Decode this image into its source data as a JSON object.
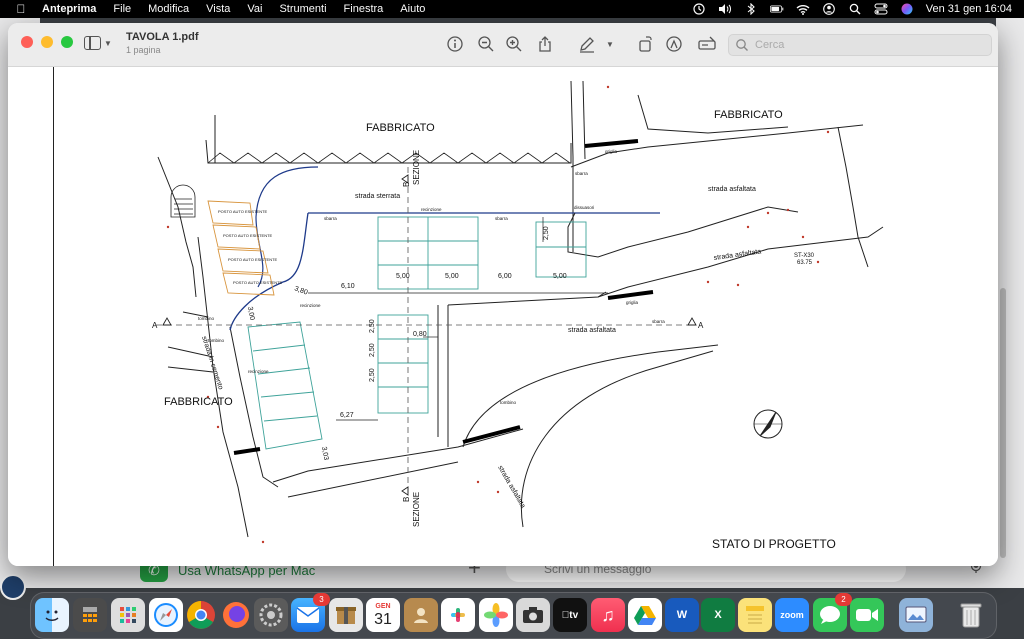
{
  "menubar": {
    "app_name": "Anteprima",
    "menus": [
      "File",
      "Modifica",
      "Vista",
      "Vai",
      "Strumenti",
      "Finestra",
      "Aiuto"
    ],
    "clock": "Ven 31 gen  16:04"
  },
  "window": {
    "title": "TAVOLA 1.pdf",
    "subtitle": "1 pagina",
    "search_placeholder": "Cerca"
  },
  "drawing": {
    "labels": {
      "fabbricato_top": "FABBRICATO",
      "fabbricato_top_right": "FABBRICATO",
      "fabbricato_left": "FABBRICATO",
      "strada_sterrata": "strada sterrata",
      "strada_asfaltata_1": "strada asfaltata",
      "strada_asfaltata_2": "strada asfaltata",
      "strada_asfaltata_3": "strada asfaltata",
      "strada_asfaltata_4": "strada asfaltata",
      "strada_in_cemento": "strada in cemento",
      "sezione_top": "SEZIONE",
      "sezione_bottom": "SEZIONE",
      "b_top": "B",
      "b_bottom": "B",
      "a_left": "A",
      "a_right": "A",
      "stato_di_progetto": "STATO DI PROGETTO",
      "posto_auto_1": "POSTO AUTO ESISTENTE",
      "posto_auto_2": "POSTO AUTO ESISTENTE",
      "posto_auto_3": "POSTO AUTO ESISTENTE",
      "posto_auto_4": "POSTO AUTO ESISTENTE",
      "recinzione_1": "recinzione",
      "recinzione_2": "recinzione",
      "recinzione_3": "recinzione",
      "sbarra_1": "sbarra",
      "sbarra_2": "sbarra",
      "sbarra_3": "sbarra",
      "sbarra_4": "sbarra",
      "griglia_1": "griglia",
      "griglia_2": "griglia",
      "dissuasori": "dissuasori",
      "tombino_1": "tombino",
      "tombino_2": "tombino",
      "tombino_3": "tombino",
      "st_label": "ST-X30",
      "st_value": "63.75"
    },
    "dimensions": {
      "d_5_00_a": "5,00",
      "d_5_00_b": "5,00",
      "d_6_00": "6,00",
      "d_5_00_c": "5,00",
      "d_6_10": "6,10",
      "d_3_80": "3,80",
      "d_3_00": "3,00",
      "d_2_50_a": "2,50",
      "d_2_50_b": "2,50",
      "d_2_50_c": "2,50",
      "d_2_50_d": "2,50",
      "d_0_80": "0,80",
      "d_6_27": "6,27",
      "d_3_03": "3,03"
    }
  },
  "background_app": {
    "whatsapp_button": "Usa WhatsApp per Mac",
    "message_placeholder": "Scrivi un messaggio"
  },
  "dock": {
    "calendar_month": "GEN",
    "calendar_day": "31",
    "mail_badge": "3",
    "messages_badge": "2",
    "apps": [
      "Finder",
      "Calcolatrice",
      "Launchpad",
      "Safari",
      "Chrome",
      "Firefox",
      "Impostazioni",
      "Mail",
      "Archiviatore",
      "Calendario",
      "Contatti",
      "Slack",
      "Foto",
      "Screenshot",
      "TV",
      "Musica",
      "Drive",
      "Word",
      "Excel",
      "Note",
      "Zoom",
      "Messaggi",
      "FaceTime",
      "Anteprima",
      "Cestino"
    ]
  }
}
